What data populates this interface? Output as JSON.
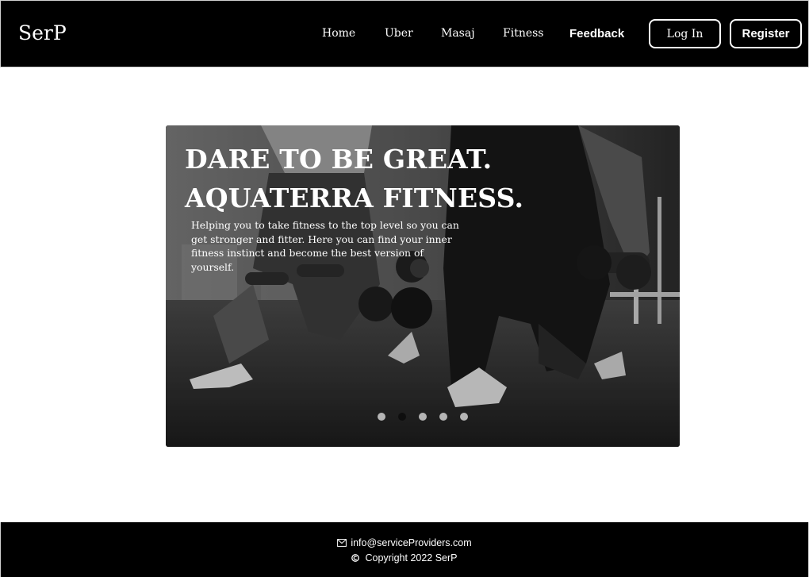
{
  "brand": {
    "logo": "SerP"
  },
  "nav": {
    "items": [
      {
        "label": "Home"
      },
      {
        "label": "Uber"
      },
      {
        "label": "Masaj"
      },
      {
        "label": "Fitness"
      },
      {
        "label": "Feedback"
      }
    ],
    "login_label": "Log In",
    "register_label": "Register"
  },
  "hero": {
    "title_line1": "DARE TO BE GREAT.",
    "title_line2": "AQUATERRA FITNESS.",
    "subtitle": "Helping you to take fitness to the top level so you can get stronger and fitter. Here you can find your inner fitness instinct and become the best version of yourself.",
    "carousel": {
      "slide_count": 5,
      "active_index": 1
    }
  },
  "footer": {
    "email": "info@serviceProviders.com",
    "email_icon": "envelope-icon",
    "copyright": "Copyright 2022 SerP",
    "copyright_icon": "copyright-icon"
  },
  "colors": {
    "header_bg": "#000000",
    "footer_bg": "#000000",
    "page_bg": "#ffffff",
    "text_on_dark": "#ffffff"
  }
}
